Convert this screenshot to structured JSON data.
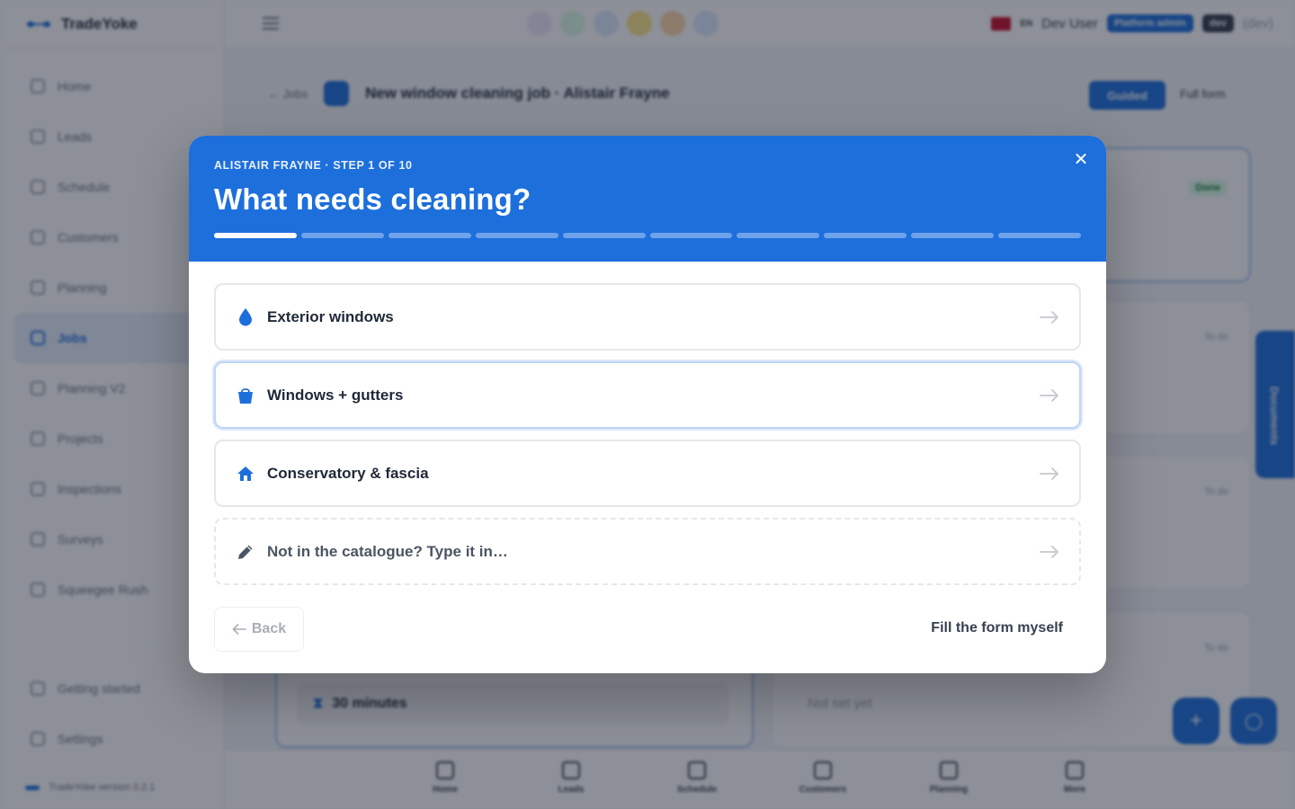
{
  "app": {
    "brand": "TradeYoke",
    "version": "TradeYoke version 0.2.1",
    "sidebar": [
      {
        "label": "Home",
        "name": "sidebar-item-home"
      },
      {
        "label": "Leads",
        "name": "sidebar-item-leads"
      },
      {
        "label": "Schedule",
        "name": "sidebar-item-schedule"
      },
      {
        "label": "Customers",
        "name": "sidebar-item-customers"
      },
      {
        "label": "Planning",
        "name": "sidebar-item-planning"
      },
      {
        "label": "Jobs",
        "name": "sidebar-item-jobs",
        "active": true
      },
      {
        "label": "Planning V2",
        "name": "sidebar-item-planning-v2"
      },
      {
        "label": "Projects",
        "name": "sidebar-item-projects"
      },
      {
        "label": "Inspections",
        "name": "sidebar-item-inspections"
      },
      {
        "label": "Surveys",
        "name": "sidebar-item-surveys"
      },
      {
        "label": "Squeegee Rush",
        "name": "sidebar-item-squeegee-rush"
      }
    ],
    "sidebar_bottom": [
      {
        "label": "Getting started",
        "name": "sidebar-item-getting-started"
      },
      {
        "label": "Settings",
        "name": "sidebar-item-settings"
      }
    ],
    "quick_colors": [
      "#ede9fe",
      "#dcfce7",
      "#dbeafe",
      "#fde68a",
      "#fed7aa",
      "#dbeafe"
    ],
    "user": {
      "lang": "EN",
      "name": "Dev User",
      "role": "Platform admin",
      "env": "dev",
      "env_text": "(dev)"
    },
    "page": {
      "back": "← Jobs",
      "title": "New window cleaning job · Alistair Frayne",
      "guided": "Guided",
      "full_form": "Full form"
    },
    "cards": {
      "done_badge": "Done",
      "todo_badge": "To do",
      "duration": "30 minutes",
      "not_set": "Not set yet"
    },
    "docs_tab": "Documents",
    "bottom_nav": [
      "Home",
      "Leads",
      "Schedule",
      "Customers",
      "Planning",
      "More"
    ]
  },
  "modal": {
    "step_label": "ALISTAIR FRAYNE · STEP 1 OF 10",
    "title": "What needs cleaning?",
    "progress": {
      "current": 1,
      "total": 10
    },
    "options": [
      {
        "label": "Exterior windows",
        "icon": "water-drop-icon",
        "name": "option-exterior-windows"
      },
      {
        "label": "Windows + gutters",
        "icon": "bucket-icon",
        "name": "option-windows-gutters",
        "focused": true
      },
      {
        "label": "Conservatory & fascia",
        "icon": "house-icon",
        "name": "option-conservatory-fascia"
      }
    ],
    "custom_option": {
      "label": "Not in the catalogue? Type it in…",
      "icon": "pencil-icon"
    },
    "back_label": "Back",
    "fill_label": "Fill the form myself",
    "accent": "#1d6fdc"
  }
}
